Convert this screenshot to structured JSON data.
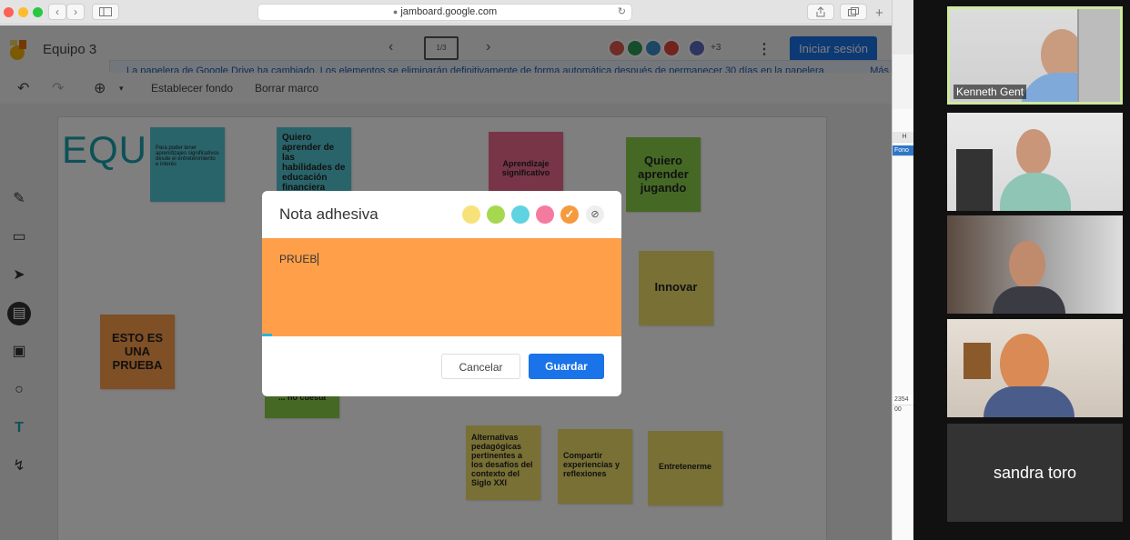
{
  "browser": {
    "url": "jamboard.google.com",
    "nav_back": "‹",
    "nav_forward": "›",
    "new_tab": "+"
  },
  "app": {
    "title": "Equipo 3",
    "frame_indicator": "1/3",
    "collaborators_more": "+3",
    "signin_label": "Iniciar sesión",
    "banner_text": "La papelera de Google Drive ha cambiado. Los elementos se eliminarán definitivamente de forma automática después de permanecer 30 días en la papelera.",
    "banner_more": "Más",
    "toolbar": {
      "set_background": "Establecer fondo",
      "clear_frame": "Borrar marco"
    }
  },
  "board": {
    "title_text": "EQUIP",
    "notes": [
      {
        "text": "Para poder tener aprendizajes significativos desde el entretenimiento e interés",
        "color": "#55c8d6"
      },
      {
        "text": "Quiero aprender de las habilidades de educación financiera",
        "color": "#55c8d6"
      },
      {
        "text": "Aprendizaje significativo",
        "color": "#f06a91"
      },
      {
        "text": "Quiero aprender jugando",
        "color": "#8bd24a"
      },
      {
        "text": "Innovar",
        "color": "#f2e06a"
      },
      {
        "text": "ESTO ES UNA PRUEBA",
        "color": "#ff9f4a"
      },
      {
        "text": "... no cuesta",
        "color": "#8bd24a"
      },
      {
        "text": "Alternativas pedagógicas pertinentes a los desafíos del contexto del Siglo XXI",
        "color": "#f2e06a"
      },
      {
        "text": "Compartir experiencias y reflexiones",
        "color": "#f2e06a"
      },
      {
        "text": "Entretenerme",
        "color": "#f2e06a"
      }
    ]
  },
  "dialog": {
    "title": "Nota adhesiva",
    "colors": [
      "#f7e27a",
      "#a5d84f",
      "#5fd3e0",
      "#f47aa0",
      "#f59a3d"
    ],
    "selected_check": "✓",
    "text_value": "PRUEB",
    "cancel_label": "Cancelar",
    "save_label": "Guardar"
  },
  "sheet": {
    "col_header": "H",
    "cell_label": "Fono",
    "cell_value": "2354 00"
  },
  "video": {
    "participants": [
      {
        "name": "Kenneth Gent",
        "active": true
      },
      {
        "name": "",
        "active": false
      },
      {
        "name": "",
        "active": false
      },
      {
        "name": "",
        "active": false
      },
      {
        "name": "sandra toro",
        "active": false
      }
    ]
  }
}
